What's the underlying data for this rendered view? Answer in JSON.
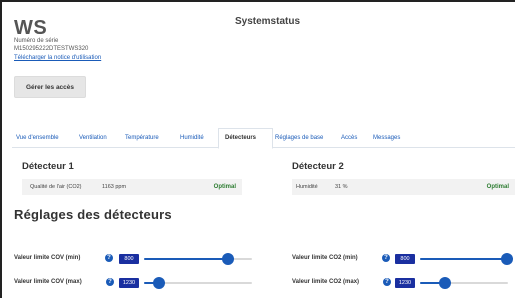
{
  "header": {
    "device_name": "WS",
    "page_title": "Systemstatus",
    "serial_label": "Numéro de série",
    "serial_value": "M150295222DTESTWS320",
    "manual_link": "Télécharger la notice d'utilisation",
    "access_button": "Gérer les accès"
  },
  "tabs": [
    {
      "label": "Vue d'ensemble",
      "active": false
    },
    {
      "label": "Ventilation",
      "active": false
    },
    {
      "label": "Température",
      "active": false
    },
    {
      "label": "Humidité",
      "active": false
    },
    {
      "label": "Détecteurs",
      "active": true
    },
    {
      "label": "Réglages de base",
      "active": false
    },
    {
      "label": "Accès",
      "active": false
    },
    {
      "label": "Messages",
      "active": false
    }
  ],
  "detectors": [
    {
      "title": "Détecteur 1",
      "label": "Qualité de l'air (CO2)",
      "value": "1163 ppm",
      "status": "Optimal"
    },
    {
      "title": "Détecteur 2",
      "label": "Humidité",
      "value": "31 %",
      "status": "Optimal"
    }
  ],
  "settings": {
    "title": "Réglages des détecteurs",
    "sliders": [
      {
        "label": "Valeur limite COV (min)",
        "value": "800",
        "level": 0.78
      },
      {
        "label": "Valeur limite COV (max)",
        "value": "1230",
        "level": 0.14
      },
      {
        "label": "Valeur limite CO2 (min)",
        "value": "800",
        "level": 0.99
      },
      {
        "label": "Valeur limite CO2 (max)",
        "value": "1230",
        "level": 0.28
      }
    ]
  },
  "colors": {
    "accent": "#1a5bb8",
    "value_box": "#1a2fa0",
    "status_ok": "#2e7d32"
  },
  "icons": {
    "help": "question-circle-icon"
  }
}
